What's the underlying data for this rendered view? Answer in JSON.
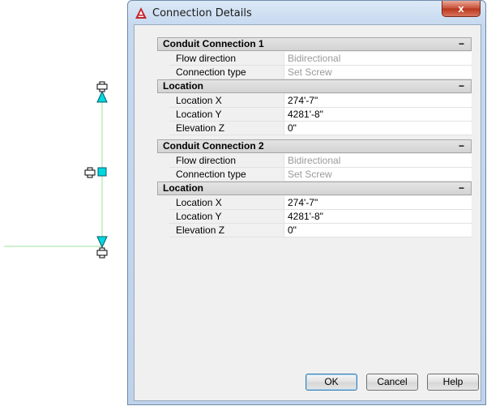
{
  "window": {
    "title": "Connection Details",
    "close_label": "x"
  },
  "sections": [
    {
      "title": "Conduit Connection 1",
      "collapse_symbol": "−",
      "rows": [
        {
          "label": "Flow direction",
          "value": "Bidirectional",
          "disabled": true
        },
        {
          "label": "Connection type",
          "value": "Set Screw",
          "disabled": true
        }
      ]
    },
    {
      "title": "Location",
      "collapse_symbol": "−",
      "rows": [
        {
          "label": "Location X",
          "value": "274'-7\"",
          "disabled": false
        },
        {
          "label": "Location Y",
          "value": "4281'-8\"",
          "disabled": false
        },
        {
          "label": "Elevation Z",
          "value": "0\"",
          "disabled": false
        }
      ]
    },
    {
      "title": "Conduit Connection 2",
      "collapse_symbol": "−",
      "rows": [
        {
          "label": "Flow direction",
          "value": "Bidirectional",
          "disabled": true
        },
        {
          "label": "Connection type",
          "value": "Set Screw",
          "disabled": true
        }
      ]
    },
    {
      "title": "Location",
      "collapse_symbol": "−",
      "rows": [
        {
          "label": "Location X",
          "value": "274'-7\"",
          "disabled": false
        },
        {
          "label": "Location Y",
          "value": "4281'-8\"",
          "disabled": false
        },
        {
          "label": "Elevation Z",
          "value": "0\"",
          "disabled": false
        }
      ]
    }
  ],
  "buttons": {
    "ok": "OK",
    "cancel": "Cancel",
    "help": "Help"
  },
  "colors": {
    "grip": "#00d8e0",
    "conduit_line": "#9ee39e",
    "app_icon": "#c4262e"
  }
}
